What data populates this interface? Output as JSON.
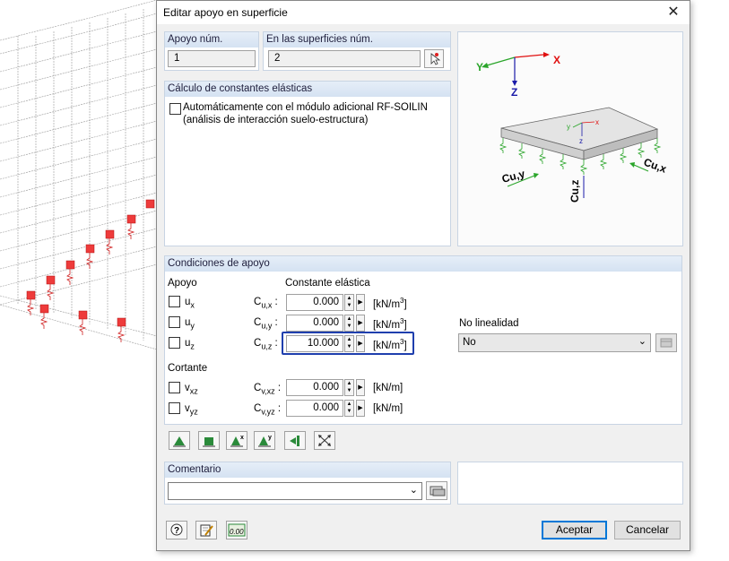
{
  "window": {
    "title": "Editar apoyo en superficie",
    "close_glyph": "✕"
  },
  "support_no": {
    "label": "Apoyo núm.",
    "value": "1"
  },
  "surfaces_no": {
    "label": "En las superficies núm.",
    "value": "2"
  },
  "elastic_calc": {
    "header": "Cálculo de constantes elásticas",
    "checkbox_line1": "Automáticamente con el módulo adicional RF-SOILIN",
    "checkbox_line2": "(análisis de interacción suelo-estructura)",
    "checked": false
  },
  "diagram": {
    "axis_x": "X",
    "axis_y": "Y",
    "axis_z": "Z",
    "small_x": "x",
    "small_y": "y",
    "small_z": "z",
    "label_cuy": "Cu,y",
    "label_cux": "Cu,x",
    "label_cuz": "Cu,z"
  },
  "conditions": {
    "header": "Condiciones de apoyo",
    "support_label": "Apoyo",
    "elastic_label": "Constante elástica",
    "shear_label": "Cortante",
    "nonlinearity_label": "No linealidad",
    "nonlinearity_value": "No",
    "rows": [
      {
        "dof": "u",
        "sub": "x",
        "const": "C",
        "csub": "u,x",
        "value": "0.000",
        "unit": "[kN/m",
        "sup": "3",
        "unit_end": "]"
      },
      {
        "dof": "u",
        "sub": "y",
        "const": "C",
        "csub": "u,y",
        "value": "0.000",
        "unit": "[kN/m",
        "sup": "3",
        "unit_end": "]"
      },
      {
        "dof": "u",
        "sub": "z",
        "const": "C",
        "csub": "u,z",
        "value": "10.000",
        "unit": "[kN/m",
        "sup": "3",
        "unit_end": "]"
      }
    ],
    "shear_rows": [
      {
        "dof": "v",
        "sub": "xz",
        "const": "C",
        "csub": "v,xz",
        "value": "0.000",
        "unit": "[kN/m]"
      },
      {
        "dof": "v",
        "sub": "yz",
        "const": "C",
        "csub": "v,yz",
        "value": "0.000",
        "unit": "[kN/m]"
      }
    ]
  },
  "comment": {
    "header": "Comentario",
    "value": ""
  },
  "buttons": {
    "ok": "Aceptar",
    "cancel": "Cancelar",
    "units_icon_text": "0.00"
  },
  "colors": {
    "accent_blue": "#0078d7",
    "highlight_box": "#1f3fae",
    "diagram_red": "#e01010",
    "diagram_green": "#2aa52a",
    "diagram_blue": "#1a1aa8"
  }
}
